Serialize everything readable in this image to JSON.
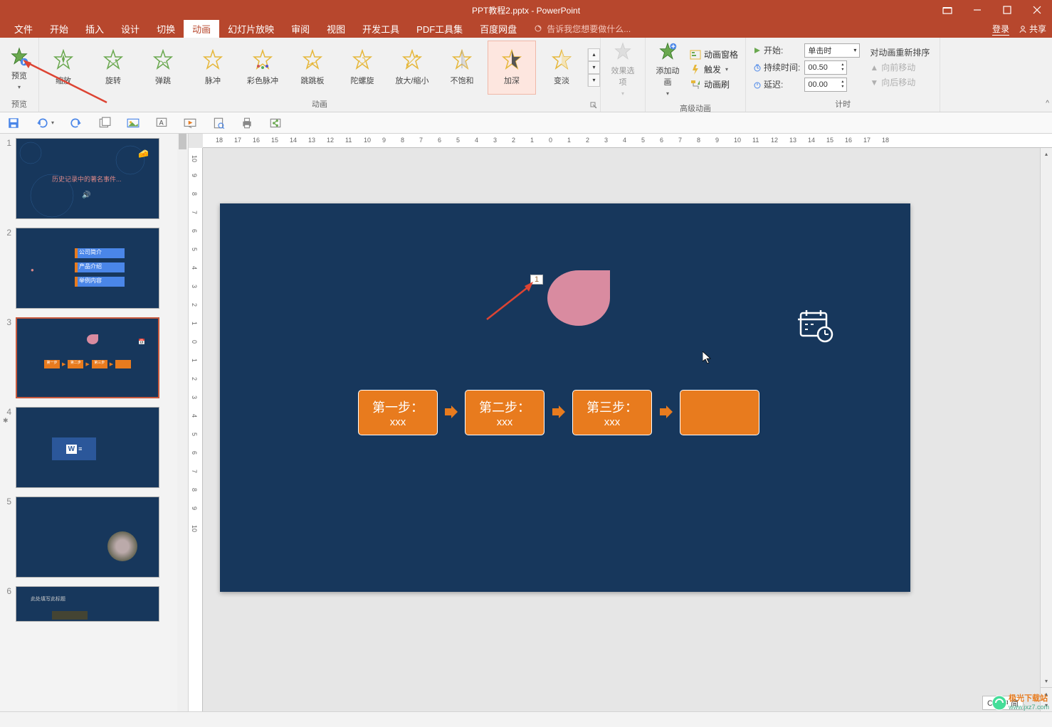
{
  "title": "PPT教程2.pptx - PowerPoint",
  "tabs": {
    "file": "文件",
    "home": "开始",
    "insert": "插入",
    "design": "设计",
    "transitions": "切换",
    "animations": "动画",
    "slideshow": "幻灯片放映",
    "review": "审阅",
    "view": "视图",
    "developer": "开发工具",
    "pdf": "PDF工具集",
    "baidu": "百度网盘"
  },
  "tellme": "告诉我您想要做什么...",
  "header_right": {
    "login": "登录",
    "share": "共享"
  },
  "ribbon": {
    "preview": {
      "label": "预览",
      "group": "预览"
    },
    "anim_gallery": {
      "zoom": "缩放",
      "spin": "旋转",
      "bounce": "弹跳",
      "pulse": "脉冲",
      "colorpulse": "彩色脉冲",
      "teeter": "跳跳板",
      "spiral": "陀螺旋",
      "growshrink": "放大/缩小",
      "desaturate": "不饱和",
      "darken": "加深",
      "lighten": "变淡"
    },
    "anim_group": "动画",
    "effect_options": "效果选项",
    "add_anim": "添加动画",
    "anim_pane": "动画窗格",
    "trigger": "触发",
    "anim_painter": "动画刷",
    "adv_group": "高级动画",
    "start_label": "开始:",
    "start_value": "单击时",
    "duration_label": "持续时间:",
    "duration_value": "00.50",
    "delay_label": "延迟:",
    "delay_value": "00.00",
    "timing_group": "计时",
    "reorder_title": "对动画重新排序",
    "move_earlier": "向前移动",
    "move_later": "向后移动"
  },
  "ruler_h": [
    "18",
    "17",
    "16",
    "15",
    "14",
    "13",
    "12",
    "11",
    "10",
    "9",
    "8",
    "7",
    "6",
    "5",
    "4",
    "3",
    "2",
    "1",
    "0",
    "1",
    "2",
    "3",
    "4",
    "5",
    "6",
    "7",
    "8",
    "9",
    "10",
    "11",
    "12",
    "13",
    "14",
    "15",
    "16",
    "17",
    "18"
  ],
  "ruler_v": [
    "10",
    "9",
    "8",
    "7",
    "6",
    "5",
    "4",
    "3",
    "2",
    "1",
    "0",
    "1",
    "2",
    "3",
    "4",
    "5",
    "6",
    "7",
    "8",
    "9",
    "10"
  ],
  "thumbnails": {
    "nums": [
      "1",
      "2",
      "3",
      "4",
      "5",
      "6"
    ]
  },
  "slide": {
    "anim_tag": "1",
    "step1_title": "第一步：",
    "step1_sub": "xxx",
    "step2_title": "第二步：",
    "step2_sub": "xxx",
    "step3_title": "第三步：",
    "step3_sub": "xxx"
  },
  "thumb_content": {
    "slide1_title": "历史记录中的著名事件...",
    "slide2_item1": "公司简介",
    "slide2_item2": "产品介绍",
    "slide2_item3": "举例内容",
    "slide3_s1": "第一步",
    "slide3_s2": "第二步",
    "slide3_s3": "第三步",
    "slide6_title": "此处填写此标题"
  },
  "watermark": "极光下载站",
  "watermark_url": "www.jxz7.com",
  "ime": "CH 中 简"
}
